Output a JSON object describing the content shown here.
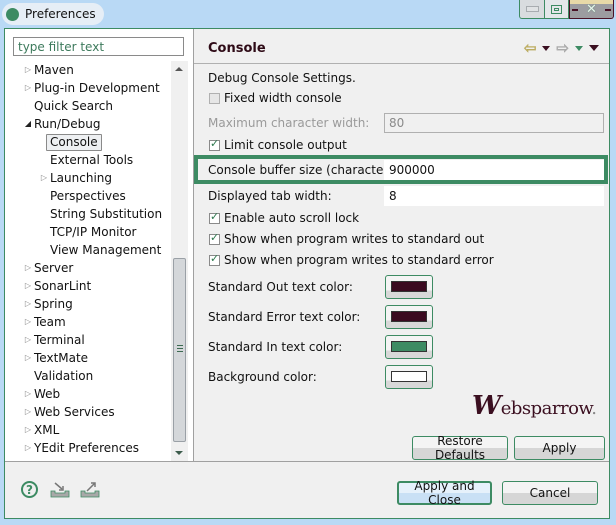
{
  "window": {
    "title": "Preferences",
    "controls": {
      "minimize": "minimize",
      "maximize": "maximize",
      "close": "close"
    }
  },
  "sidebar": {
    "filter_placeholder": "type filter text",
    "items": [
      {
        "label": "Maven",
        "level": 0,
        "expander": "collapsed"
      },
      {
        "label": "Plug-in Development",
        "level": 0,
        "expander": "collapsed"
      },
      {
        "label": "Quick Search",
        "level": 0,
        "expander": "none"
      },
      {
        "label": "Run/Debug",
        "level": 0,
        "expander": "expanded"
      },
      {
        "label": "Console",
        "level": 1,
        "expander": "none",
        "selected": true
      },
      {
        "label": "External Tools",
        "level": 1,
        "expander": "none"
      },
      {
        "label": "Launching",
        "level": 1,
        "expander": "collapsed"
      },
      {
        "label": "Perspectives",
        "level": 1,
        "expander": "none"
      },
      {
        "label": "String Substitution",
        "level": 1,
        "expander": "none"
      },
      {
        "label": "TCP/IP Monitor",
        "level": 1,
        "expander": "none"
      },
      {
        "label": "View Management",
        "level": 1,
        "expander": "none"
      },
      {
        "label": "Server",
        "level": 0,
        "expander": "collapsed"
      },
      {
        "label": "SonarLint",
        "level": 0,
        "expander": "collapsed"
      },
      {
        "label": "Spring",
        "level": 0,
        "expander": "collapsed"
      },
      {
        "label": "Team",
        "level": 0,
        "expander": "collapsed"
      },
      {
        "label": "Terminal",
        "level": 0,
        "expander": "collapsed"
      },
      {
        "label": "TextMate",
        "level": 0,
        "expander": "collapsed"
      },
      {
        "label": "Validation",
        "level": 0,
        "expander": "none"
      },
      {
        "label": "Web",
        "level": 0,
        "expander": "collapsed"
      },
      {
        "label": "Web Services",
        "level": 0,
        "expander": "collapsed"
      },
      {
        "label": "XML",
        "level": 0,
        "expander": "collapsed"
      },
      {
        "label": "YEdit Preferences",
        "level": 0,
        "expander": "collapsed"
      }
    ]
  },
  "page": {
    "title": "Console",
    "nav": {
      "back": "back",
      "forward": "forward",
      "menu": "view-menu"
    },
    "section_label": "Debug Console Settings.",
    "fixed_width": {
      "label": "Fixed width console",
      "checked": false
    },
    "max_char_width": {
      "label": "Maximum character width:",
      "value": "80",
      "enabled": false
    },
    "limit_output": {
      "label": "Limit console output",
      "checked": true
    },
    "buffer_size": {
      "label": "Console buffer size (characters):",
      "value": "900000"
    },
    "tab_width": {
      "label": "Displayed tab width:",
      "value": "8"
    },
    "auto_scroll": {
      "label": "Enable auto scroll lock",
      "checked": true
    },
    "show_stdout": {
      "label": "Show when program writes to standard out",
      "checked": true
    },
    "show_stderr": {
      "label": "Show when program writes to standard error",
      "checked": true
    },
    "colors": [
      {
        "label": "Standard Out text color:",
        "color": "#3b0a20"
      },
      {
        "label": "Standard Error text color:",
        "color": "#3b0a20"
      },
      {
        "label": "Standard In text color:",
        "color": "#3d8b63"
      },
      {
        "label": "Background color:",
        "color": "#ffffff"
      }
    ],
    "watermark": {
      "initial": "W",
      "rest": "ebsparrow",
      "dot": "."
    },
    "restore_defaults": "Restore Defaults",
    "apply": "Apply"
  },
  "footer": {
    "help": "?",
    "apply_close": "Apply and Close",
    "cancel": "Cancel"
  },
  "theme": {
    "accent": "#3d8b63",
    "maroon": "#3b0f20"
  }
}
